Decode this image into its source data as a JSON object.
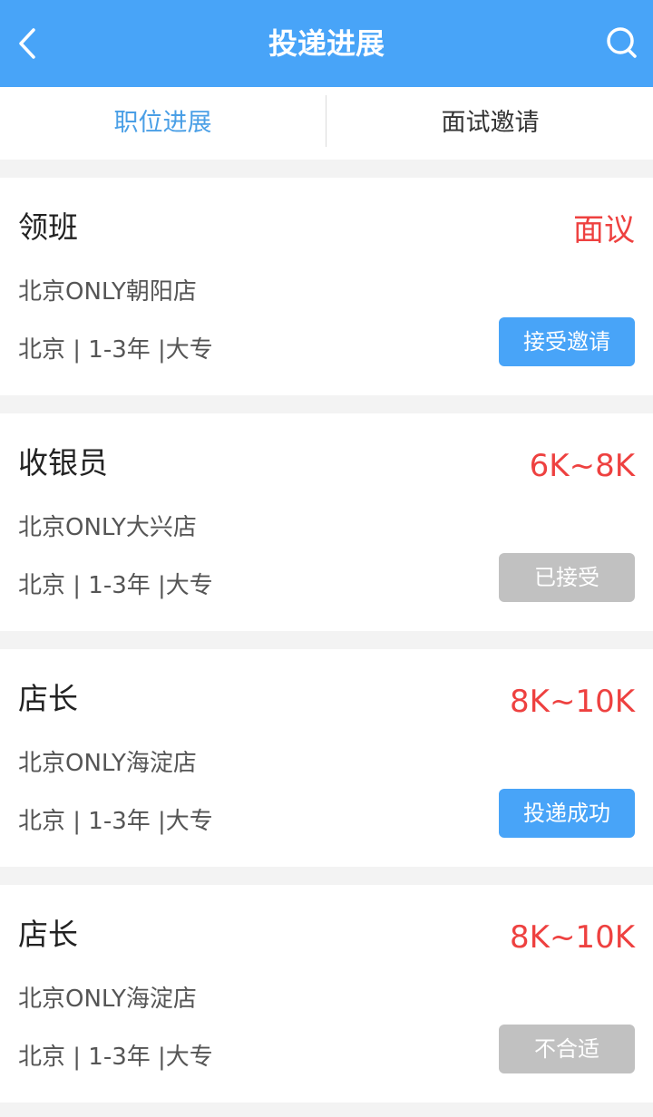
{
  "header": {
    "title": "投递进展",
    "back_icon": "chevron-left-icon",
    "search_icon": "search-icon"
  },
  "tabs": [
    {
      "label": "职位进展",
      "active": true
    },
    {
      "label": "面试邀请",
      "active": false
    }
  ],
  "colors": {
    "brand_blue": "#48a4f8",
    "salary_red": "#ee4140",
    "inactive_gray": "#c1c1c1"
  },
  "jobs": [
    {
      "title": "领班",
      "salary": "面议",
      "company": "北京ONLY朝阳店",
      "meta": "北京 | 1-3年 |大专",
      "status": "接受邀请",
      "status_style": "blue"
    },
    {
      "title": "收银员",
      "salary": "6K~8K",
      "company": "北京ONLY大兴店",
      "meta": "北京 | 1-3年 |大专",
      "status": "已接受",
      "status_style": "gray"
    },
    {
      "title": "店长",
      "salary": "8K~10K",
      "company": "北京ONLY海淀店",
      "meta": "北京 | 1-3年 |大专",
      "status": "投递成功",
      "status_style": "blue"
    },
    {
      "title": "店长",
      "salary": "8K~10K",
      "company": "北京ONLY海淀店",
      "meta": "北京 | 1-3年 |大专",
      "status": "不合适",
      "status_style": "gray"
    }
  ]
}
